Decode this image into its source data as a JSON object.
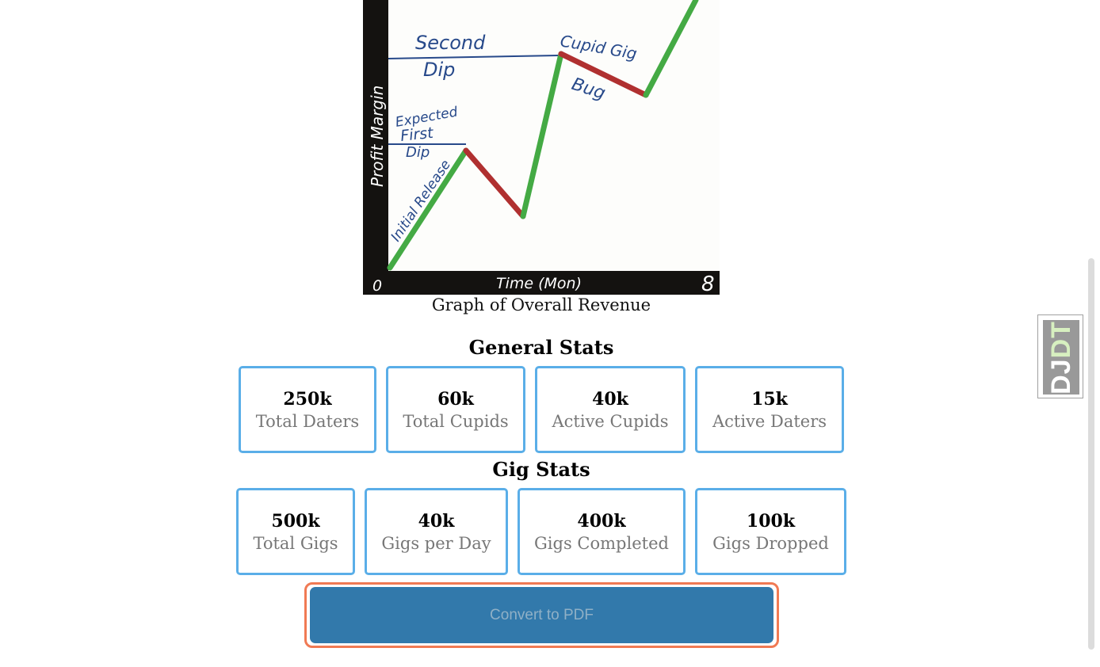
{
  "graph": {
    "image_alt": "Graph of Overall Revenue",
    "caption": "Graph of Overall Revenue",
    "y_axis_label": "Profit Margin",
    "x_axis_label": "Time (Mon)",
    "x_origin_label": "0",
    "x_end_label": "8",
    "annotations": {
      "second_dip_1": "Second",
      "second_dip_2": "Dip",
      "cupid_gig_1": "Cupid Gig",
      "cupid_gig_2": "Bug",
      "expected_1": "Expected",
      "expected_2": "First",
      "expected_3": "Dip",
      "initial_release": "Initial Release"
    },
    "colors": {
      "rise": "#44aa44",
      "fall": "#b03030",
      "frame": "#141210",
      "ink": "#27498a"
    }
  },
  "general_stats": {
    "title": "General Stats",
    "items": [
      {
        "value": "250k",
        "label": "Total Daters"
      },
      {
        "value": "60k",
        "label": "Total Cupids"
      },
      {
        "value": "40k",
        "label": "Active Cupids"
      },
      {
        "value": "15k",
        "label": "Active Daters"
      }
    ]
  },
  "gig_stats": {
    "title": "Gig Stats",
    "items": [
      {
        "value": "500k",
        "label": "Total Gigs"
      },
      {
        "value": "40k",
        "label": "Gigs per Day"
      },
      {
        "value": "400k",
        "label": "Gigs Completed"
      },
      {
        "value": "100k",
        "label": "Gigs Dropped"
      }
    ]
  },
  "actions": {
    "convert_pdf_label": "Convert to PDF"
  },
  "debug_toolbar": {
    "label_main": "DJ",
    "label_accent": "DT"
  },
  "theme": {
    "card_border": "#5aaee8",
    "button_bg": "#3279ab",
    "button_outline": "#f07a54"
  }
}
